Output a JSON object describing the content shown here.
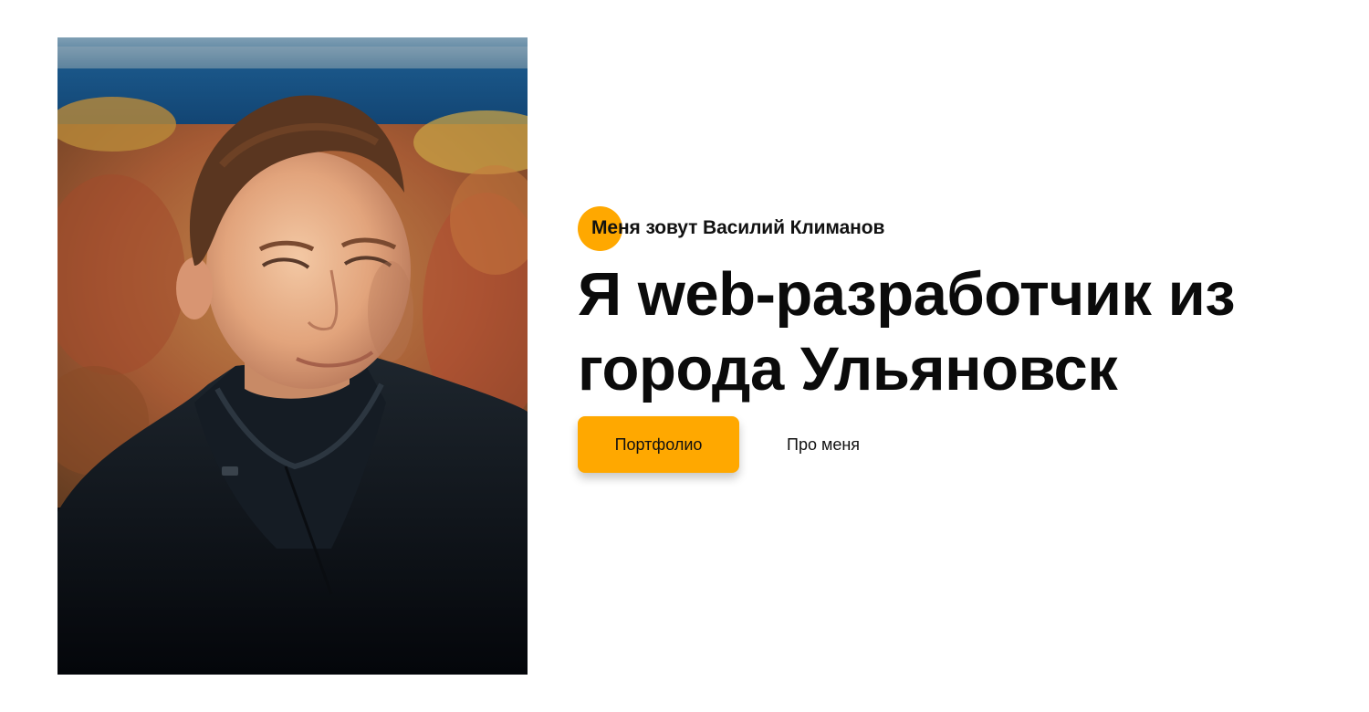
{
  "hero": {
    "tagline": "Меня зовут Василий Климанов",
    "headline": "Я web-разработчик из города Ульяновск",
    "buttons": {
      "portfolio": "Портфолио",
      "about": "Про меня"
    }
  },
  "colors": {
    "accent": "#ffa800",
    "text": "#0b0b0b",
    "background": "#ffffff"
  },
  "photo": {
    "icon": "portrait-photo"
  }
}
